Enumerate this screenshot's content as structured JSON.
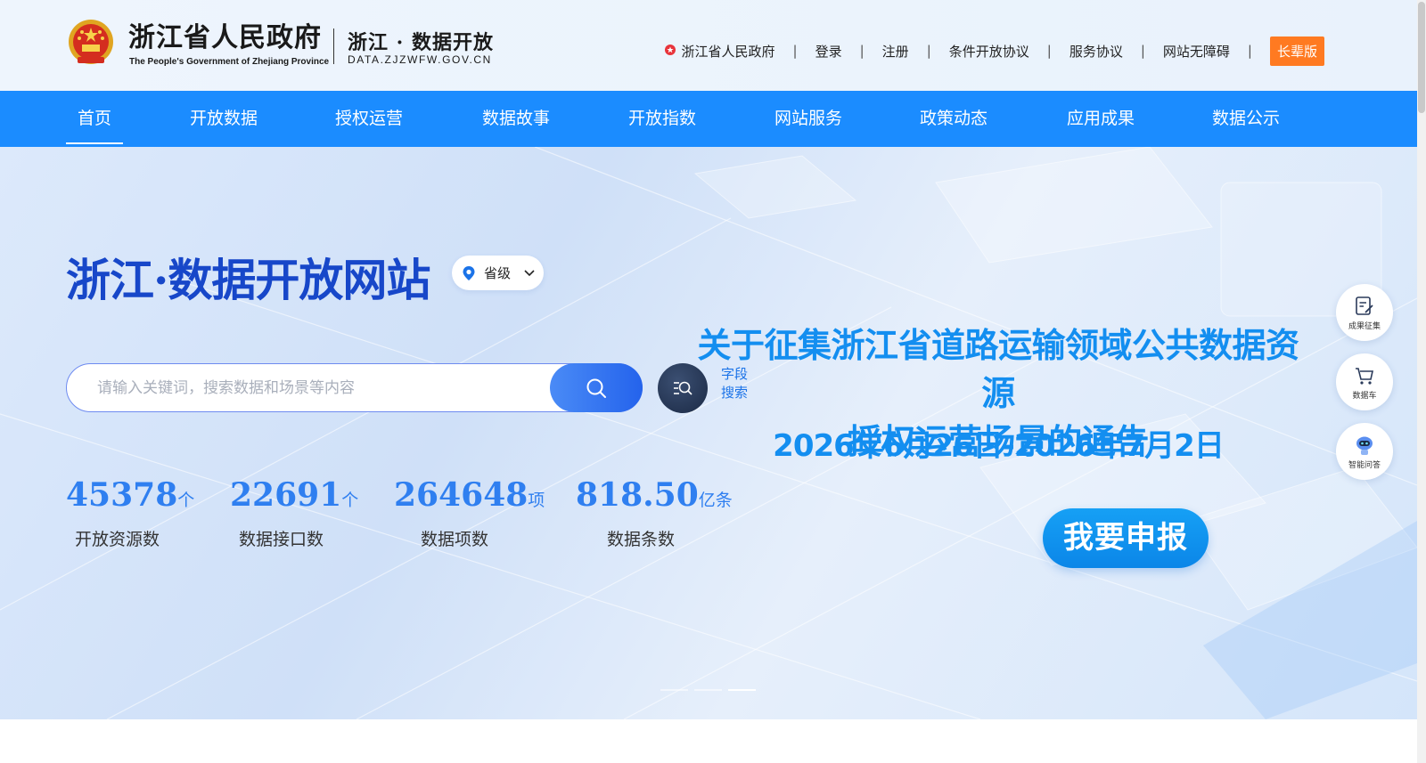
{
  "header": {
    "gov_name_cn": "浙江省人民政府",
    "gov_name_en": "The People's Government of Zhejiang Province",
    "site_name": "浙江 · 数据开放",
    "site_url": "DATA.ZJZWFW.GOV.CN",
    "emblem_icon": "national-emblem-icon",
    "top_links": {
      "gov_portal": "浙江省人民政府",
      "login": "登录",
      "register": "注册",
      "conditional_agreement": "条件开放协议",
      "service_agreement": "服务协议",
      "accessibility": "网站无障碍",
      "elder_mode": "长辈版",
      "separator": "|"
    }
  },
  "nav": {
    "items": [
      "首页",
      "开放数据",
      "授权运营",
      "数据故事",
      "开放指数",
      "网站服务",
      "政策动态",
      "应用成果",
      "数据公示"
    ],
    "active_index": 0
  },
  "hero": {
    "title": "浙江·数据开放网站",
    "region_selector": "省级",
    "search_placeholder": "请输入关键词，搜索数据和场景等内容",
    "search_value": "",
    "field_search_label": "字段搜索"
  },
  "stats": [
    {
      "value": "45378",
      "unit": "个",
      "label": "开放资源数"
    },
    {
      "value": "22691",
      "unit": "个",
      "label": "数据接口数"
    },
    {
      "value": "264648",
      "unit": "项",
      "label": "数据项数"
    },
    {
      "value": "818.50",
      "unit": "亿条",
      "label": "数据条数"
    }
  ],
  "notice": {
    "title_line1": "关于征集浙江省道路运输领域公共数据资源",
    "title_line2": "授权运营场景的通告",
    "date_range": "2026年6月26日-2026年7月2日",
    "apply_button": "我要申报"
  },
  "carousel": {
    "slide_count": 3,
    "active_slide": 3
  },
  "side_tools": [
    {
      "label": "成果征集",
      "icon": "edit-document-icon"
    },
    {
      "label": "数据车",
      "icon": "cart-icon"
    },
    {
      "label": "智能问答",
      "icon": "robot-icon"
    }
  ],
  "colors": {
    "nav_bg": "#1b8cff",
    "accent_blue": "#2f7ff0",
    "title_blue": "#1747c9",
    "notice_blue": "#138ef0",
    "elder_orange": "#ff7a21"
  }
}
